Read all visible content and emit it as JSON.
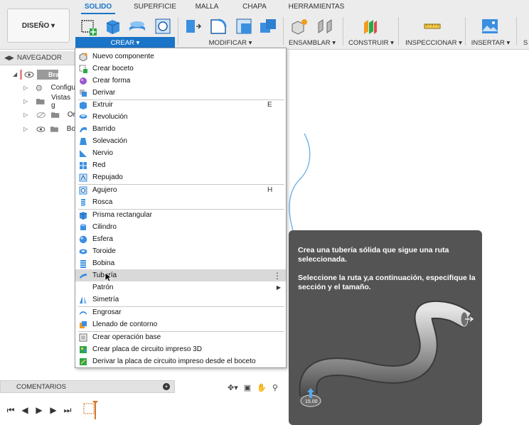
{
  "toolbar": {
    "design_label": "DISEÑO ▾",
    "tabs": [
      "SOLIDO",
      "SUPERFICIE",
      "MALLA",
      "CHAPA",
      "HERRAMIENTAS"
    ],
    "groups": [
      "CREAR ▾",
      "MODIFICAR ▾",
      "ENSAMBLAR ▾",
      "CONSTRUIR ▾",
      "INSPECCIONAR ▾",
      "INSERTAR ▾",
      "S"
    ]
  },
  "navigator": {
    "title": "NAVEGADOR",
    "items": [
      {
        "label": "Braz"
      },
      {
        "label": "Configu"
      },
      {
        "label": "Vistas g"
      },
      {
        "label": "Or"
      },
      {
        "label": "Bo"
      }
    ]
  },
  "create_menu": {
    "items": [
      {
        "label": "Nuevo componente",
        "shortcut": ""
      },
      {
        "label": "Crear boceto",
        "shortcut": ""
      },
      {
        "label": "Crear forma",
        "shortcut": ""
      },
      {
        "label": "Derivar",
        "shortcut": ""
      },
      {
        "label": "Extruir",
        "shortcut": "E"
      },
      {
        "label": "Revolución",
        "shortcut": ""
      },
      {
        "label": "Barrido",
        "shortcut": ""
      },
      {
        "label": "Solevación",
        "shortcut": ""
      },
      {
        "label": "Nervio",
        "shortcut": ""
      },
      {
        "label": "Red",
        "shortcut": ""
      },
      {
        "label": "Repujado",
        "shortcut": ""
      },
      {
        "label": "Agujero",
        "shortcut": "H"
      },
      {
        "label": "Rosca",
        "shortcut": ""
      },
      {
        "label": "Prisma rectangular",
        "shortcut": ""
      },
      {
        "label": "Cilindro",
        "shortcut": ""
      },
      {
        "label": "Esfera",
        "shortcut": ""
      },
      {
        "label": "Toroide",
        "shortcut": ""
      },
      {
        "label": "Bobina",
        "shortcut": ""
      },
      {
        "label": "Tubería",
        "shortcut": ""
      },
      {
        "label": "Patrón",
        "shortcut": ""
      },
      {
        "label": "Simetría",
        "shortcut": ""
      },
      {
        "label": "Engrosar",
        "shortcut": ""
      },
      {
        "label": "Llenado de contorno",
        "shortcut": ""
      },
      {
        "label": "Crear operación base",
        "shortcut": ""
      },
      {
        "label": "Crear placa de circuito impreso 3D",
        "shortcut": ""
      },
      {
        "label": "Derivar la placa de circuito impreso desde el boceto",
        "shortcut": ""
      }
    ]
  },
  "tooltip": {
    "line1": "Crea una tubería sólida que sigue una ruta seleccionada.",
    "line2": "Seleccione la ruta y,a continuación, especifique la sección y el tamaño.",
    "dimension": "15.00"
  },
  "bottom": {
    "comments_label": "COMENTARIOS"
  },
  "colors": {
    "accent": "#1a74c8",
    "tooltip_bg": "#545454",
    "menu_hover": "#d9d9d9"
  }
}
